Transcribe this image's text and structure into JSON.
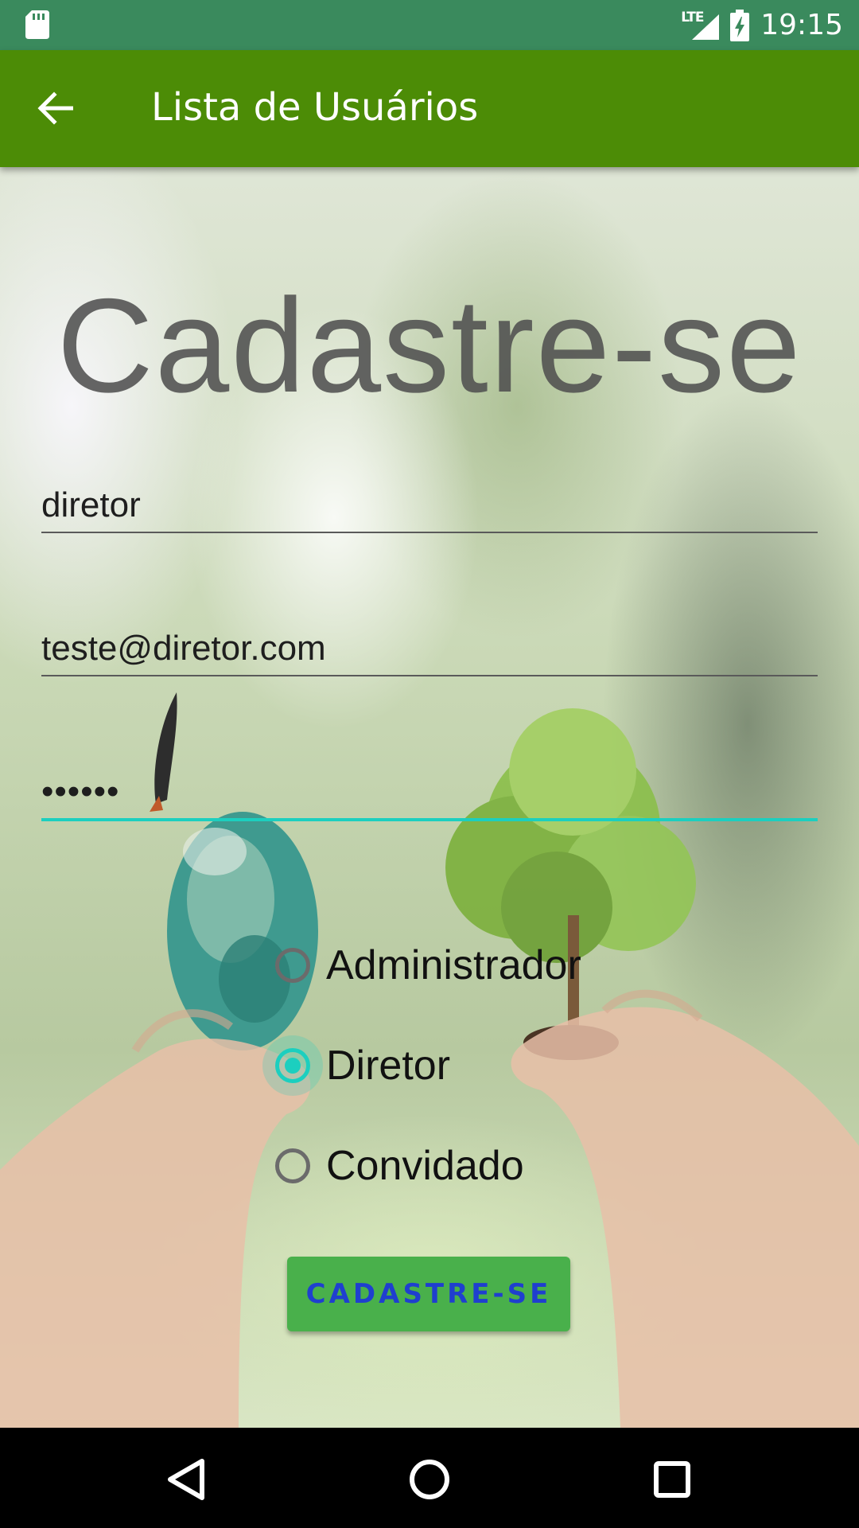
{
  "status_bar": {
    "time": "19:15",
    "network": "LTE",
    "icons": [
      "sd-card-icon",
      "signal-icon",
      "battery-charging-icon"
    ]
  },
  "app_bar": {
    "title": "Lista de Usuários",
    "back_icon": "arrow-back-icon"
  },
  "form": {
    "heading": "Cadastre-se",
    "name_value": "diretor",
    "email_value": "teste@diretor.com",
    "password_value": "••••••",
    "roles": [
      {
        "label": "Administrador",
        "checked": false
      },
      {
        "label": "Diretor",
        "checked": true
      },
      {
        "label": "Convidado",
        "checked": false
      }
    ],
    "submit_label": "CADASTRE-SE"
  },
  "colors": {
    "status_bar": "#3a8a5d",
    "app_bar": "#4c8c06",
    "accent": "#1ccfbf",
    "button": "#49b04b",
    "button_text": "#1f3fcf"
  },
  "nav_bar": {
    "icons": [
      "back-triangle-icon",
      "home-circle-icon",
      "recents-square-icon"
    ]
  }
}
